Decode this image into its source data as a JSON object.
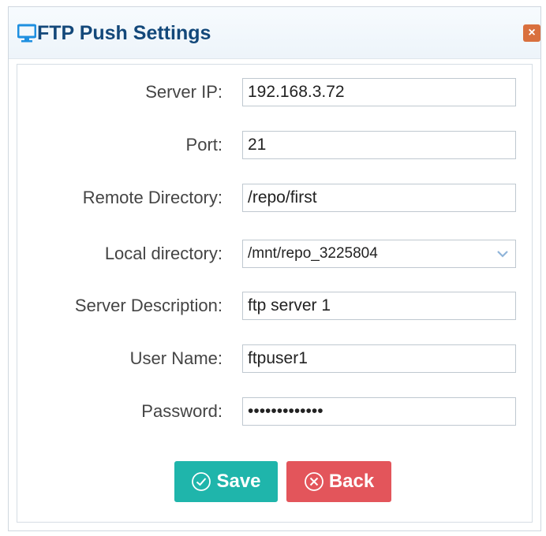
{
  "dialog": {
    "title": "FTP Push Settings",
    "close_symbol": "×"
  },
  "icons": {
    "title": "monitor-icon",
    "close": "close-icon",
    "dropdown": "chevron-down-icon",
    "save": "check-circle-icon",
    "back": "x-circle-icon"
  },
  "form": {
    "server_ip": {
      "label": "Server IP:",
      "value": "192.168.3.72"
    },
    "port": {
      "label": "Port:",
      "value": "21"
    },
    "remote_directory": {
      "label": "Remote Directory:",
      "value": "/repo/first"
    },
    "local_directory": {
      "label": "Local directory:",
      "value": "/mnt/repo_3225804"
    },
    "server_description": {
      "label": "Server Description:",
      "value": "ftp server 1"
    },
    "user_name": {
      "label": "User Name:",
      "value": "ftpuser1"
    },
    "password": {
      "label": "Password:",
      "value": "•••••••••••••"
    }
  },
  "buttons": {
    "save": "Save",
    "back": "Back"
  },
  "colors": {
    "title": "#13487a",
    "save": "#1fb5ab",
    "back": "#e3555b",
    "close": "#d9703e",
    "icon_blue": "#1e8fe0"
  }
}
